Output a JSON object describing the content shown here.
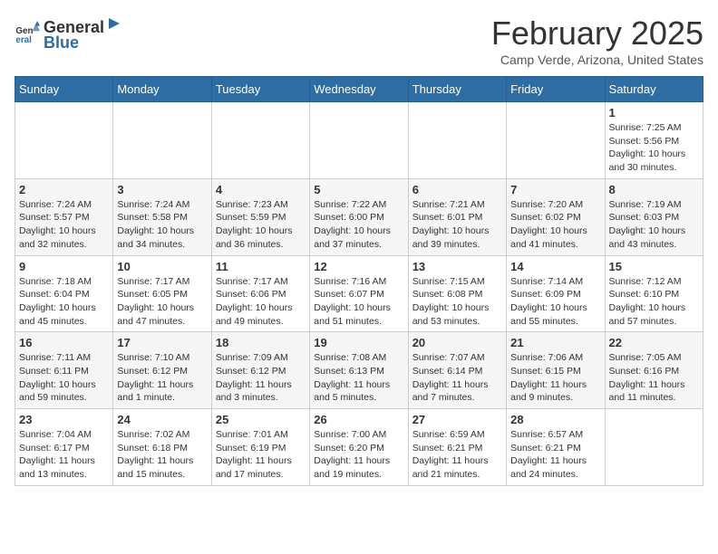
{
  "header": {
    "logo_general": "General",
    "logo_blue": "Blue",
    "month_title": "February 2025",
    "subtitle": "Camp Verde, Arizona, United States"
  },
  "calendar": {
    "days_of_week": [
      "Sunday",
      "Monday",
      "Tuesday",
      "Wednesday",
      "Thursday",
      "Friday",
      "Saturday"
    ],
    "weeks": [
      [
        {
          "day": "",
          "info": ""
        },
        {
          "day": "",
          "info": ""
        },
        {
          "day": "",
          "info": ""
        },
        {
          "day": "",
          "info": ""
        },
        {
          "day": "",
          "info": ""
        },
        {
          "day": "",
          "info": ""
        },
        {
          "day": "1",
          "info": "Sunrise: 7:25 AM\nSunset: 5:56 PM\nDaylight: 10 hours and 30 minutes."
        }
      ],
      [
        {
          "day": "2",
          "info": "Sunrise: 7:24 AM\nSunset: 5:57 PM\nDaylight: 10 hours and 32 minutes."
        },
        {
          "day": "3",
          "info": "Sunrise: 7:24 AM\nSunset: 5:58 PM\nDaylight: 10 hours and 34 minutes."
        },
        {
          "day": "4",
          "info": "Sunrise: 7:23 AM\nSunset: 5:59 PM\nDaylight: 10 hours and 36 minutes."
        },
        {
          "day": "5",
          "info": "Sunrise: 7:22 AM\nSunset: 6:00 PM\nDaylight: 10 hours and 37 minutes."
        },
        {
          "day": "6",
          "info": "Sunrise: 7:21 AM\nSunset: 6:01 PM\nDaylight: 10 hours and 39 minutes."
        },
        {
          "day": "7",
          "info": "Sunrise: 7:20 AM\nSunset: 6:02 PM\nDaylight: 10 hours and 41 minutes."
        },
        {
          "day": "8",
          "info": "Sunrise: 7:19 AM\nSunset: 6:03 PM\nDaylight: 10 hours and 43 minutes."
        }
      ],
      [
        {
          "day": "9",
          "info": "Sunrise: 7:18 AM\nSunset: 6:04 PM\nDaylight: 10 hours and 45 minutes."
        },
        {
          "day": "10",
          "info": "Sunrise: 7:17 AM\nSunset: 6:05 PM\nDaylight: 10 hours and 47 minutes."
        },
        {
          "day": "11",
          "info": "Sunrise: 7:17 AM\nSunset: 6:06 PM\nDaylight: 10 hours and 49 minutes."
        },
        {
          "day": "12",
          "info": "Sunrise: 7:16 AM\nSunset: 6:07 PM\nDaylight: 10 hours and 51 minutes."
        },
        {
          "day": "13",
          "info": "Sunrise: 7:15 AM\nSunset: 6:08 PM\nDaylight: 10 hours and 53 minutes."
        },
        {
          "day": "14",
          "info": "Sunrise: 7:14 AM\nSunset: 6:09 PM\nDaylight: 10 hours and 55 minutes."
        },
        {
          "day": "15",
          "info": "Sunrise: 7:12 AM\nSunset: 6:10 PM\nDaylight: 10 hours and 57 minutes."
        }
      ],
      [
        {
          "day": "16",
          "info": "Sunrise: 7:11 AM\nSunset: 6:11 PM\nDaylight: 10 hours and 59 minutes."
        },
        {
          "day": "17",
          "info": "Sunrise: 7:10 AM\nSunset: 6:12 PM\nDaylight: 11 hours and 1 minute."
        },
        {
          "day": "18",
          "info": "Sunrise: 7:09 AM\nSunset: 6:12 PM\nDaylight: 11 hours and 3 minutes."
        },
        {
          "day": "19",
          "info": "Sunrise: 7:08 AM\nSunset: 6:13 PM\nDaylight: 11 hours and 5 minutes."
        },
        {
          "day": "20",
          "info": "Sunrise: 7:07 AM\nSunset: 6:14 PM\nDaylight: 11 hours and 7 minutes."
        },
        {
          "day": "21",
          "info": "Sunrise: 7:06 AM\nSunset: 6:15 PM\nDaylight: 11 hours and 9 minutes."
        },
        {
          "day": "22",
          "info": "Sunrise: 7:05 AM\nSunset: 6:16 PM\nDaylight: 11 hours and 11 minutes."
        }
      ],
      [
        {
          "day": "23",
          "info": "Sunrise: 7:04 AM\nSunset: 6:17 PM\nDaylight: 11 hours and 13 minutes."
        },
        {
          "day": "24",
          "info": "Sunrise: 7:02 AM\nSunset: 6:18 PM\nDaylight: 11 hours and 15 minutes."
        },
        {
          "day": "25",
          "info": "Sunrise: 7:01 AM\nSunset: 6:19 PM\nDaylight: 11 hours and 17 minutes."
        },
        {
          "day": "26",
          "info": "Sunrise: 7:00 AM\nSunset: 6:20 PM\nDaylight: 11 hours and 19 minutes."
        },
        {
          "day": "27",
          "info": "Sunrise: 6:59 AM\nSunset: 6:21 PM\nDaylight: 11 hours and 21 minutes."
        },
        {
          "day": "28",
          "info": "Sunrise: 6:57 AM\nSunset: 6:21 PM\nDaylight: 11 hours and 24 minutes."
        },
        {
          "day": "",
          "info": ""
        }
      ]
    ]
  }
}
